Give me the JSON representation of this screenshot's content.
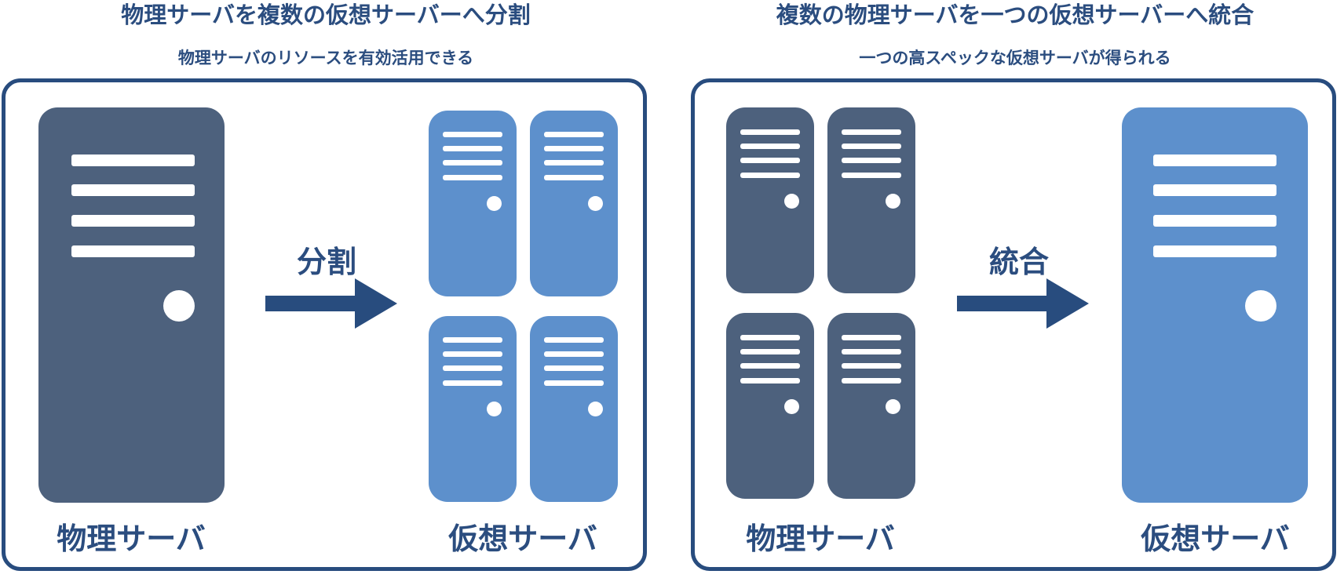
{
  "left": {
    "title": "物理サーバを複数の仮想サーバーへ分割",
    "subtitle": "物理サーバのリソースを有効活用できる",
    "arrow_label": "分割",
    "source_label": "物理サーバ",
    "target_label": "仮想サーバ"
  },
  "right": {
    "title": "複数の物理サーバを一つの仮想サーバーへ統合",
    "subtitle": "一つの高スペックな仮想サーバが得られる",
    "arrow_label": "統合",
    "source_label": "物理サーバ",
    "target_label": "仮想サーバ"
  },
  "colors": {
    "physical_server": "#4d617d",
    "virtual_server": "#5d90cc",
    "accent": "#284c7e",
    "text": "#2b4d7f"
  },
  "icons": {
    "server": "server-tower-icon",
    "arrow": "right-arrow-icon"
  }
}
